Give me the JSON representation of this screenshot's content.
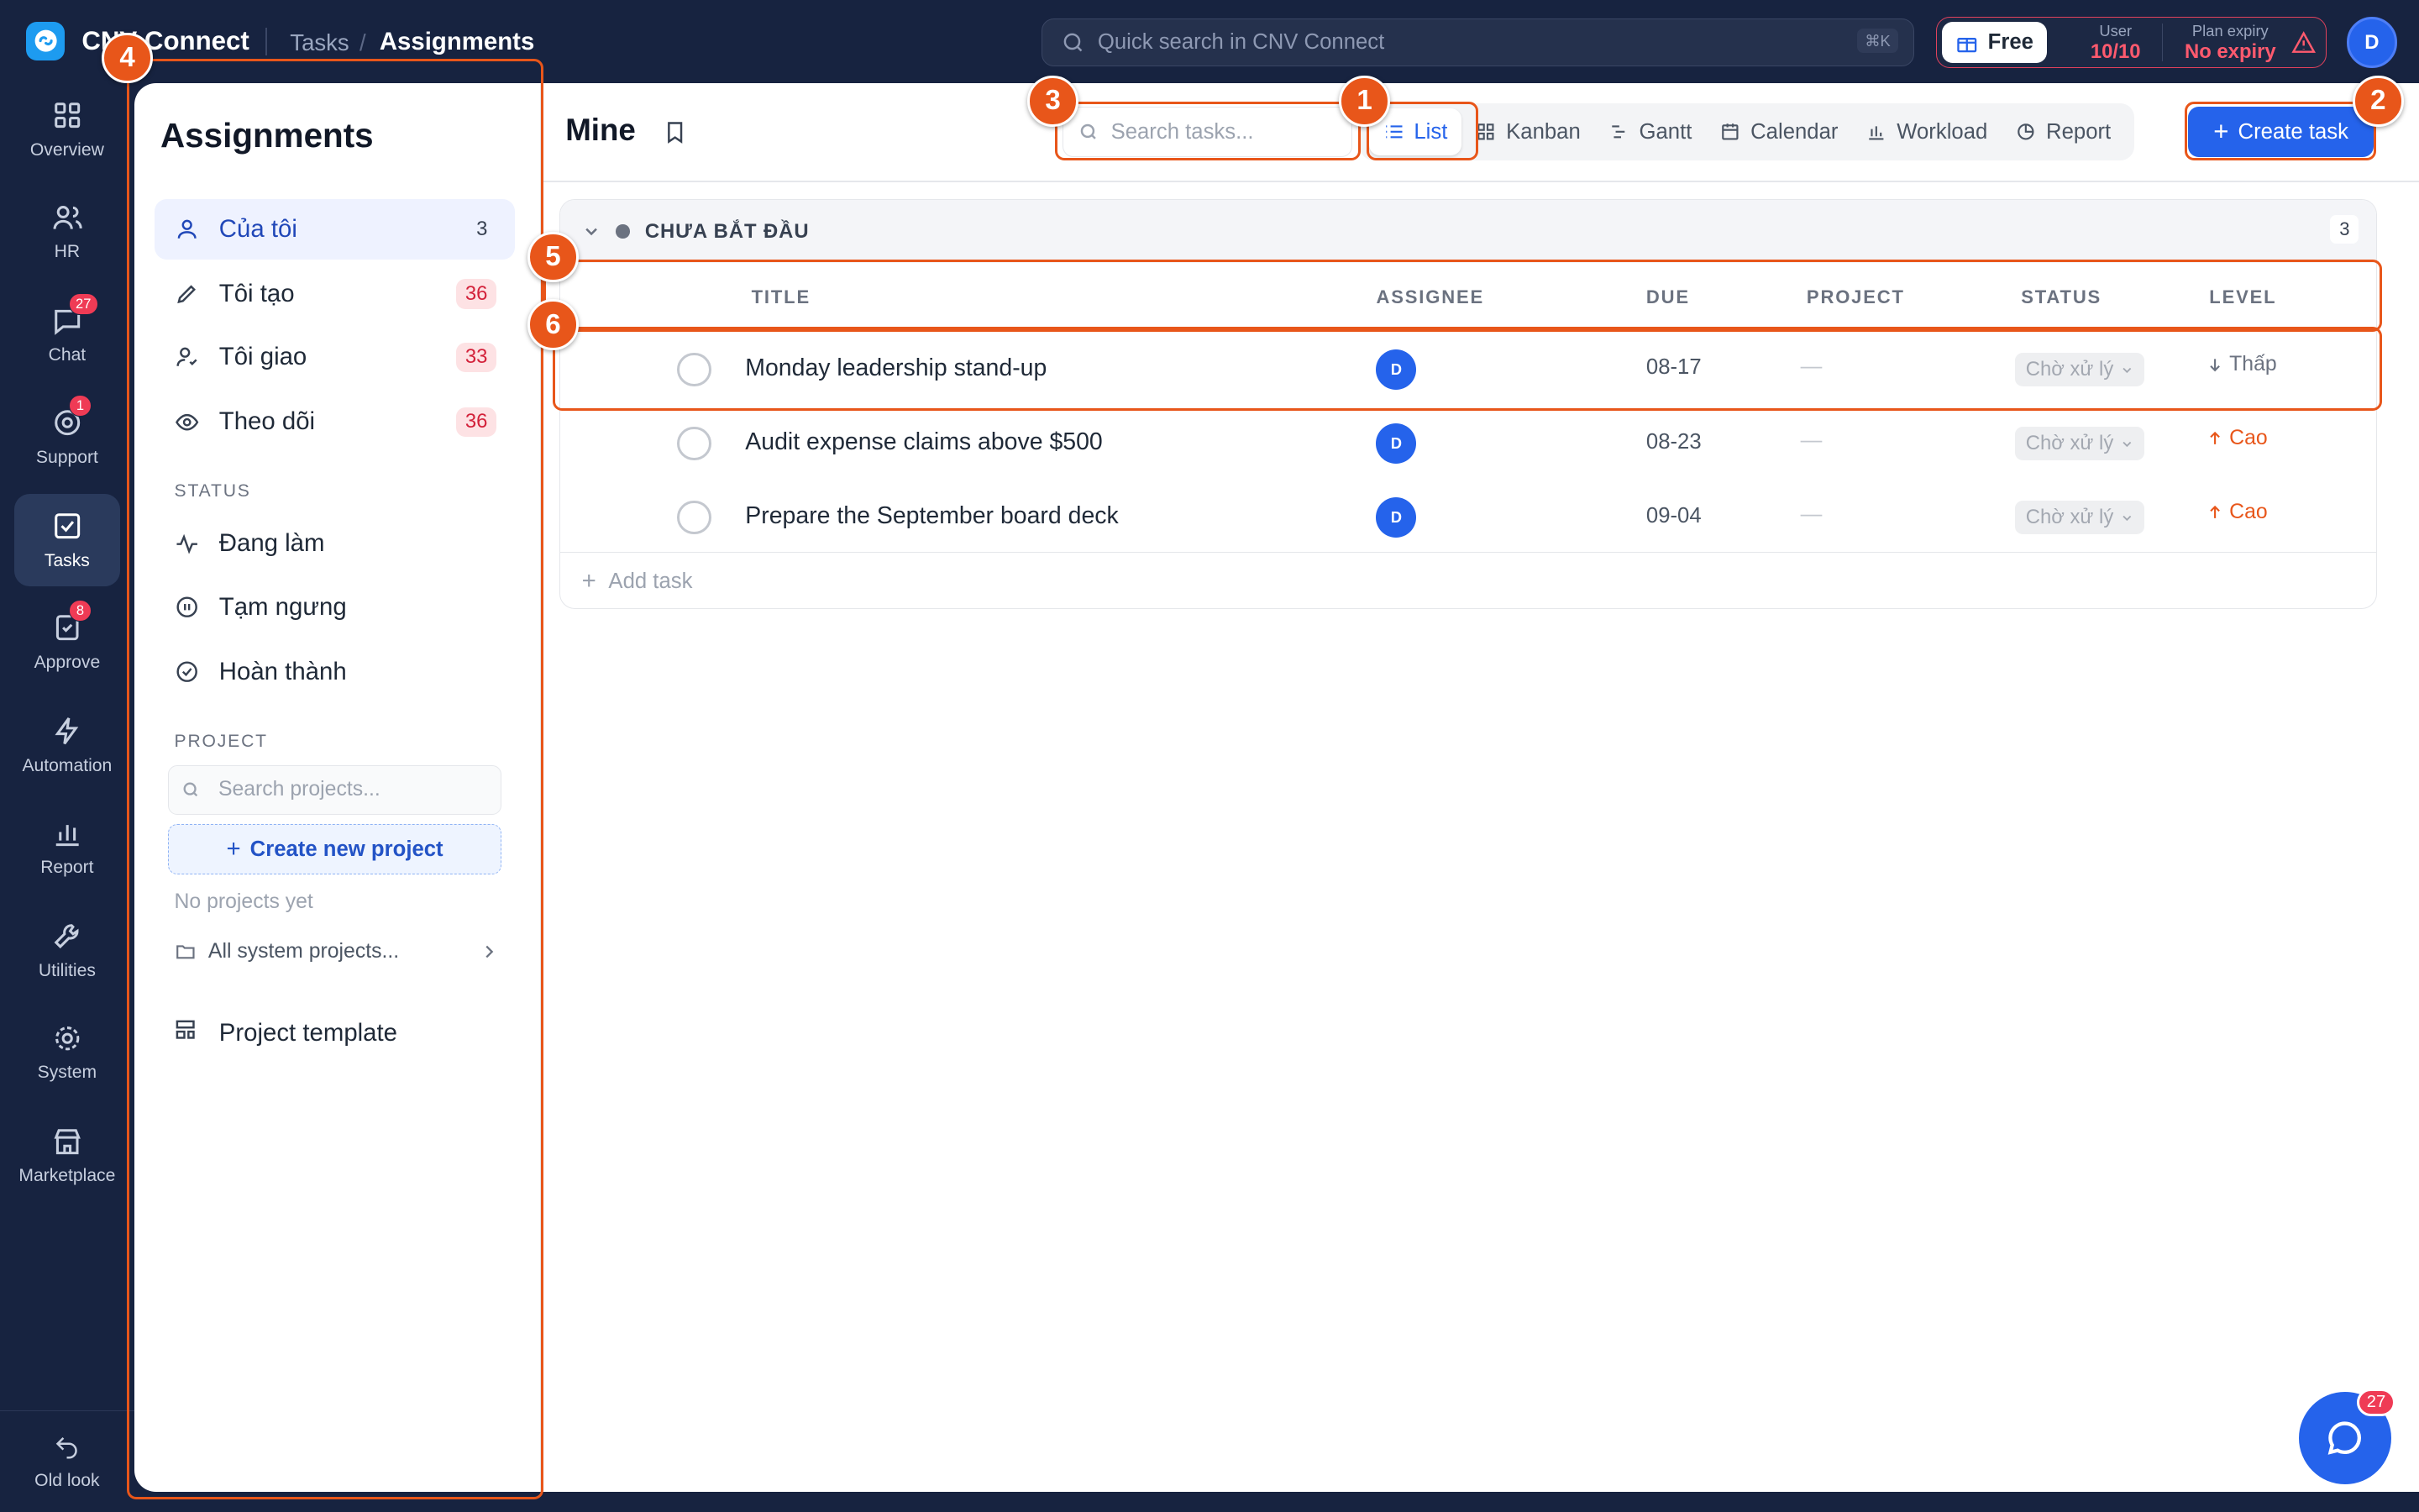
{
  "app": {
    "name": "CNV Connect",
    "breadcrumb": [
      "Tasks",
      "Assignments"
    ]
  },
  "global_search": {
    "placeholder": "Quick search in CNV Connect",
    "shortcut": "⌘K"
  },
  "plan": {
    "name": "Free",
    "user_label": "User",
    "user_value": "10/10",
    "expiry_label": "Plan expiry",
    "expiry_value": "No expiry"
  },
  "user_avatar": "D",
  "rail": [
    {
      "label": "Overview",
      "icon": "grid-icon",
      "badge": null
    },
    {
      "label": "HR",
      "icon": "users-icon",
      "badge": null
    },
    {
      "label": "Chat",
      "icon": "chat-icon",
      "badge": "27"
    },
    {
      "label": "Support",
      "icon": "support-icon",
      "badge": "1"
    },
    {
      "label": "Tasks",
      "icon": "task-check-icon",
      "badge": null,
      "active": true
    },
    {
      "label": "Approve",
      "icon": "approve-icon",
      "badge": "8"
    },
    {
      "label": "Automation",
      "icon": "bolt-icon",
      "badge": null
    },
    {
      "label": "Report",
      "icon": "bar-chart-icon",
      "badge": null
    },
    {
      "label": "Utilities",
      "icon": "wrench-icon",
      "badge": null
    },
    {
      "label": "System",
      "icon": "gear-icon",
      "badge": null
    },
    {
      "label": "Marketplace",
      "icon": "store-icon",
      "badge": null
    }
  ],
  "rail_bottom": {
    "label": "Old look",
    "icon": "undo-icon"
  },
  "panel": {
    "title": "Assignments",
    "items": [
      {
        "label": "Của tôi",
        "count": "3",
        "icon": "user-icon"
      },
      {
        "label": "Tôi tạo",
        "count": "36",
        "icon": "pencil-icon"
      },
      {
        "label": "Tôi giao",
        "count": "33",
        "icon": "user-assign-icon"
      },
      {
        "label": "Theo dõi",
        "count": "36",
        "icon": "eye-icon"
      }
    ],
    "status_title": "STATUS",
    "status_items": [
      {
        "label": "Đang làm",
        "icon": "activity-icon"
      },
      {
        "label": "Tạm ngưng",
        "icon": "pause-icon"
      },
      {
        "label": "Hoàn thành",
        "icon": "check-circle-icon"
      }
    ],
    "project_title": "PROJECT",
    "project_search_placeholder": "Search projects...",
    "create_project": "Create new project",
    "no_projects": "No projects yet",
    "all_system_projects": "All system projects...",
    "project_template": "Project template"
  },
  "main": {
    "title": "Mine",
    "search_placeholder": "Search tasks...",
    "views": [
      {
        "label": "List",
        "icon": "list-icon",
        "active": true
      },
      {
        "label": "Kanban",
        "icon": "kanban-icon"
      },
      {
        "label": "Gantt",
        "icon": "gantt-icon"
      },
      {
        "label": "Calendar",
        "icon": "calendar-icon"
      },
      {
        "label": "Workload",
        "icon": "workload-icon"
      },
      {
        "label": "Report",
        "icon": "report-icon"
      }
    ],
    "create_task": "Create task",
    "group": {
      "name": "CHƯA BẮT ĐẦU",
      "count": "3",
      "columns": [
        "TITLE",
        "ASSIGNEE",
        "DUE",
        "PROJECT",
        "STATUS",
        "LEVEL"
      ],
      "tasks": [
        {
          "title": "Monday leadership stand-up",
          "assignee": "D",
          "due": "08-17",
          "project": "—",
          "status": "Chờ xử lý",
          "level": "Thấp",
          "level_dir": "down",
          "level_color": "#6b7280"
        },
        {
          "title": "Audit expense claims above $500",
          "assignee": "D",
          "due": "08-23",
          "project": "—",
          "status": "Chờ xử lý",
          "level": "Cao",
          "level_dir": "up",
          "level_color": "#e8561a"
        },
        {
          "title": "Prepare the September board deck",
          "assignee": "D",
          "due": "09-04",
          "project": "—",
          "status": "Chờ xử lý",
          "level": "Cao",
          "level_dir": "up",
          "level_color": "#e8561a"
        }
      ],
      "add_task": "Add task"
    }
  },
  "markers": [
    "1",
    "2",
    "3",
    "4",
    "5",
    "6"
  ],
  "chat_fab_badge": "27"
}
